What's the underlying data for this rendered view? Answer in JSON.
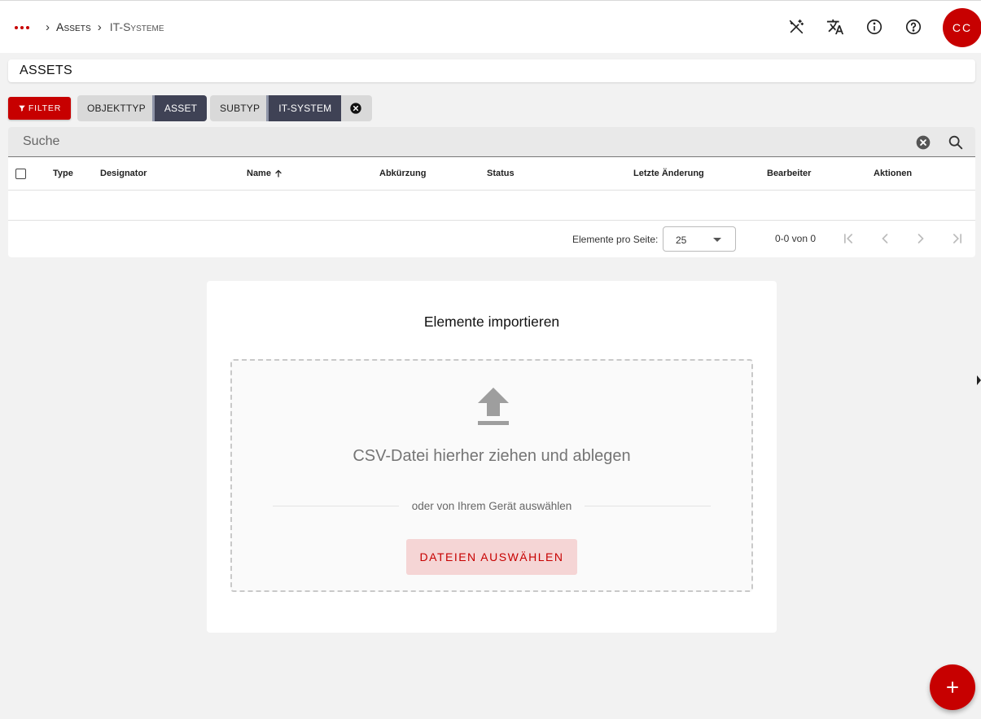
{
  "topbar": {
    "breadcrumb": [
      {
        "label": "Assets"
      },
      {
        "label": "IT-Systeme"
      }
    ],
    "avatar_initials": "CC",
    "icons": [
      "magic-wand-off-icon",
      "translate-icon",
      "info-icon",
      "help-icon"
    ]
  },
  "page": {
    "title": "ASSETS"
  },
  "filters": {
    "button_label": "FILTER",
    "chips": [
      {
        "key": "OBJEKTTYP",
        "value": "ASSET"
      },
      {
        "key": "SUBTYP",
        "value": "IT-SYSTEM"
      }
    ]
  },
  "search": {
    "placeholder": "Suche"
  },
  "table": {
    "columns": [
      "Type",
      "Designator",
      "Name",
      "Abkürzung",
      "Status",
      "Letzte Änderung",
      "Bearbeiter",
      "Aktionen"
    ],
    "sorted_column": "Name",
    "sort_direction": "ascending",
    "rows": []
  },
  "paginator": {
    "items_per_page_label": "Elemente pro Seite:",
    "items_per_page_value": "25",
    "range_label": "0-0 von 0"
  },
  "import": {
    "title": "Elemente importieren",
    "drop_text": "CSV-Datei hierher ziehen und ablegen",
    "or_text": "oder von Ihrem Gerät auswählen",
    "button_label": "DATEIEN AUSWÄHLEN"
  },
  "colors": {
    "accent": "#c70000",
    "chip_value_bg": "#3f4255",
    "background": "#f2f2f2"
  }
}
